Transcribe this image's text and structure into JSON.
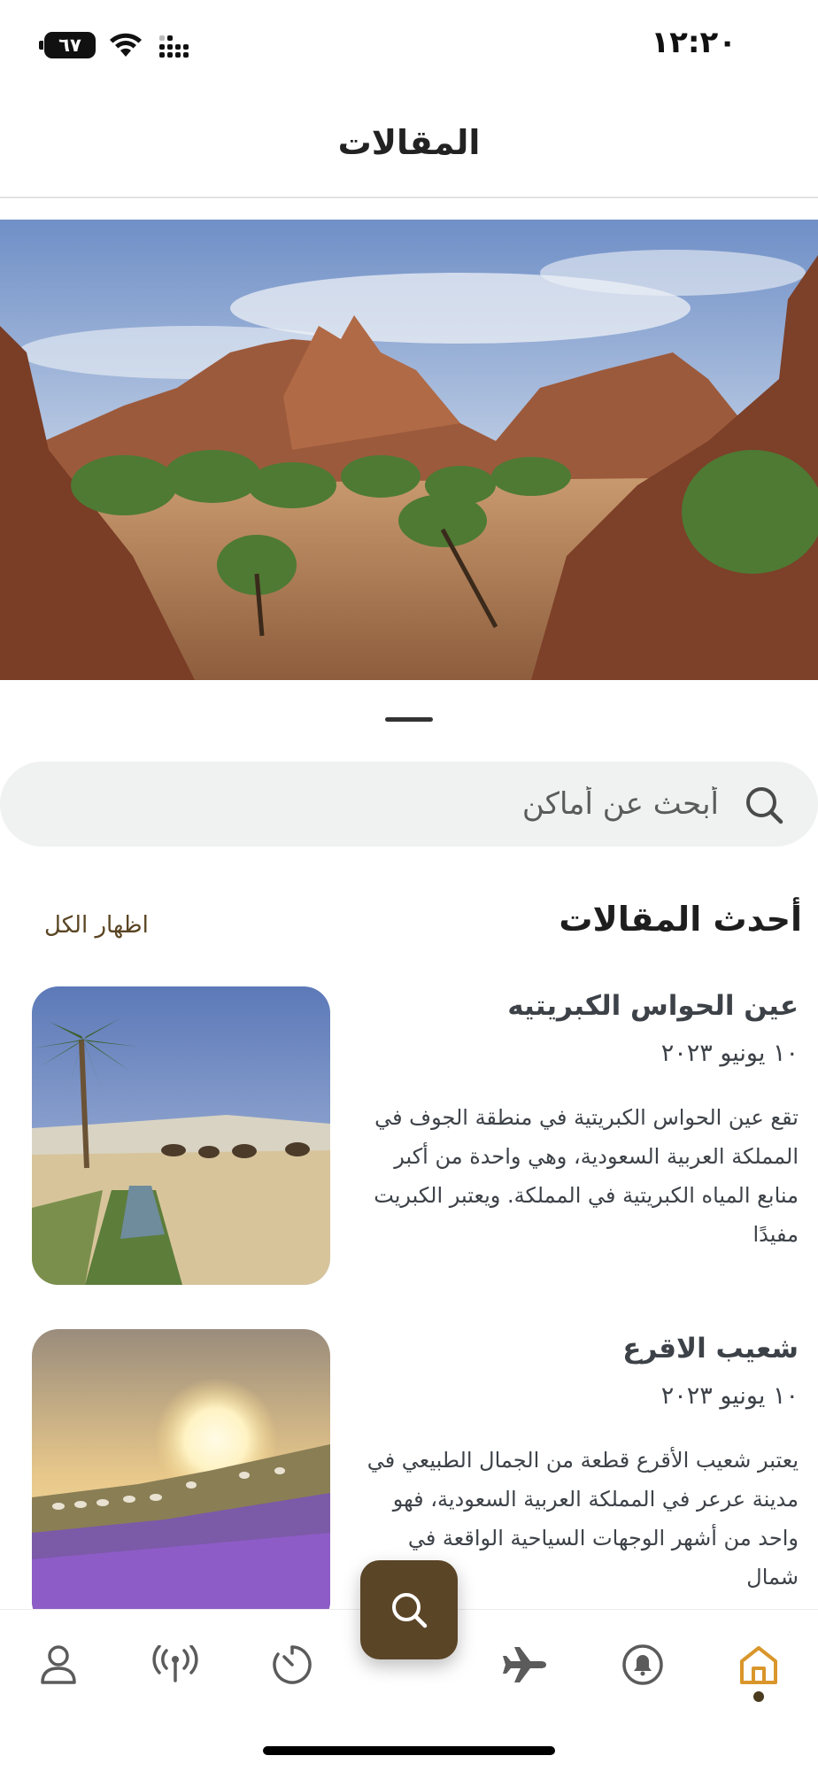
{
  "status_bar": {
    "battery": "٦٧",
    "time": "١٢:٢٠"
  },
  "header": {
    "title": "المقالات"
  },
  "search": {
    "placeholder": "أبحث عن أماكن"
  },
  "latest": {
    "title": "أحدث المقالات",
    "show_all": "اظهار الكل"
  },
  "articles": [
    {
      "title": "عين الحواس الكبريتيه",
      "date": "١٠ يونيو ٢٠٢٣",
      "excerpt": "تقع عين الحواس الكبريتية في منطقة الجوف في المملكة العربية السعودية، وهي واحدة من أكبر منابع المياه الكبريتية في المملكة. ويعتبر الكبريت مفيدًا"
    },
    {
      "title": "شعيب الاقرع",
      "date": "١٠ يونيو ٢٠٢٣",
      "excerpt": "يعتبر شعيب الأقرع قطعة من الجمال الطبيعي في مدينة عرعر في المملكة العربية السعودية، فهو واحد من أشهر الوجهات السياحية الواقعة في شمال"
    }
  ],
  "nav": {
    "items": [
      "profile-icon",
      "broadcast-icon",
      "timer-icon",
      "search-icon",
      "airplane-icon",
      "bell-icon",
      "home-icon"
    ],
    "active": "home-icon",
    "active_color": "#d9962b",
    "fab_color": "#5b4527"
  }
}
